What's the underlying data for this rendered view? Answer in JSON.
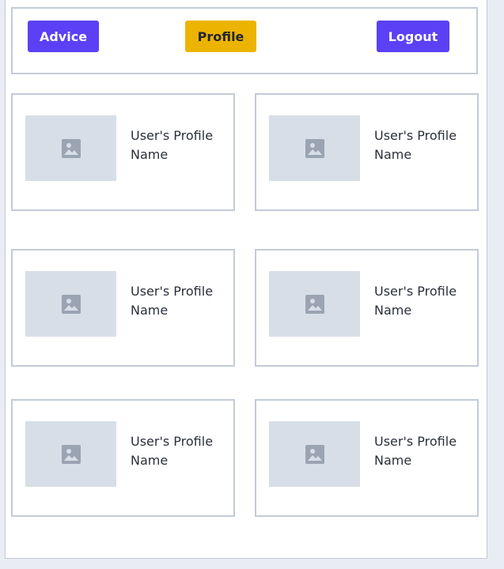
{
  "header": {
    "advice_label": "Advice",
    "profile_label": "Profile",
    "logout_label": "Logout"
  },
  "colors": {
    "primary_button": "#5b40f5",
    "highlight_button": "#ecb400",
    "border": "#c3cbd6",
    "placeholder_bg": "#d8dee7",
    "placeholder_icon": "#9aa4b2"
  },
  "profiles": [
    {
      "name": "User's Profile Name",
      "icon": "image-placeholder-icon"
    },
    {
      "name": "User's Profile Name",
      "icon": "image-placeholder-icon"
    },
    {
      "name": "User's Profile Name",
      "icon": "image-placeholder-icon"
    },
    {
      "name": "User's Profile Name",
      "icon": "image-placeholder-icon"
    },
    {
      "name": "User's Profile Name",
      "icon": "image-placeholder-icon"
    },
    {
      "name": "User's Profile Name",
      "icon": "image-placeholder-icon"
    }
  ]
}
